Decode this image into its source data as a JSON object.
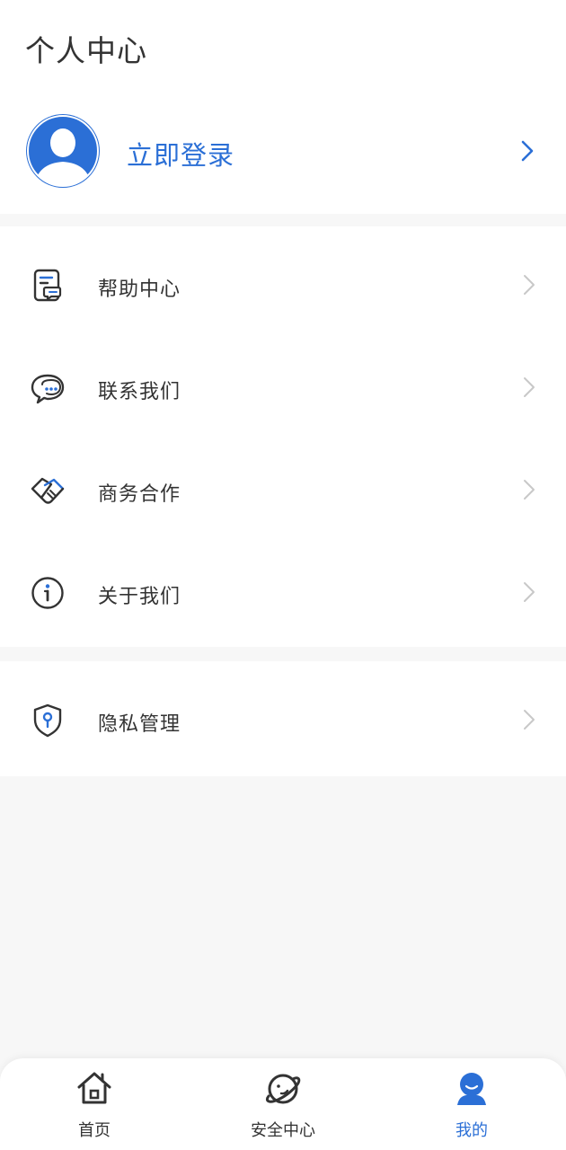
{
  "header": {
    "title": "个人中心"
  },
  "login": {
    "label": "立即登录"
  },
  "menu": {
    "group1": [
      {
        "label": "帮助中心",
        "icon": "help-document-icon"
      },
      {
        "label": "联系我们",
        "icon": "chat-bubble-icon"
      },
      {
        "label": "商务合作",
        "icon": "handshake-icon"
      },
      {
        "label": "关于我们",
        "icon": "info-icon"
      }
    ],
    "group2": [
      {
        "label": "隐私管理",
        "icon": "privacy-shield-icon"
      }
    ]
  },
  "tabbar": {
    "items": [
      {
        "label": "首页",
        "icon": "home-icon",
        "active": false
      },
      {
        "label": "安全中心",
        "icon": "planet-icon",
        "active": false
      },
      {
        "label": "我的",
        "icon": "profile-icon",
        "active": true
      }
    ]
  },
  "colors": {
    "accent": "#2b6fd6",
    "text": "#333333",
    "chevron": "#c8c8c8",
    "background": "#f7f7f7"
  }
}
